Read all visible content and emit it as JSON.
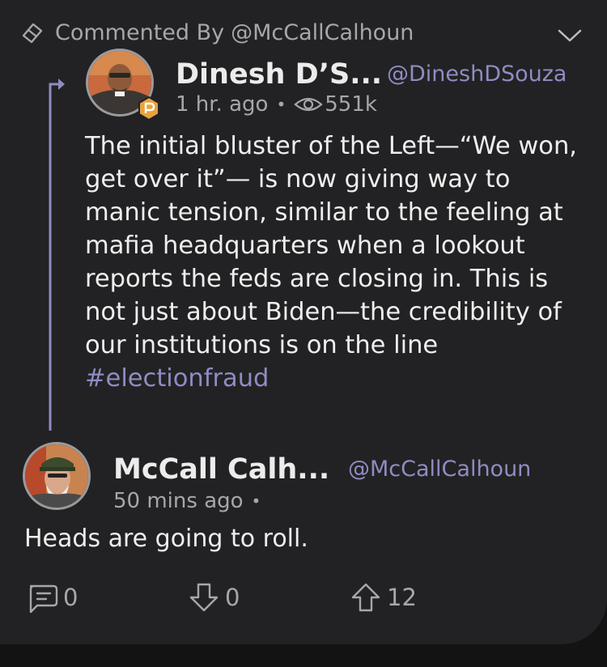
{
  "header": {
    "prefix": "Commented By",
    "handle": "@McCallCalhoun"
  },
  "original_post": {
    "author_name": "Dinesh D’S...",
    "author_handle": "@DineshDSouza",
    "time": "1 hr. ago",
    "separator": "•",
    "views": "551k",
    "text": "The initial bluster of the Left—“We won, get over it”— is now giving way to manic tension, similar to the feeling at mafia headquarters when a lookout reports the feds are closing in. This is not just about Biden—the credibility of our institutions is on the line",
    "hashtag": "#electionfraud"
  },
  "comment": {
    "author_name": "McCall Calh...",
    "author_handle": "@McCallCalhoun",
    "time": "50 mins ago",
    "separator": "•",
    "text": "Heads are going to roll."
  },
  "actions": {
    "reply_count": "0",
    "downvote_count": "0",
    "upvote_count": "12"
  },
  "colors": {
    "background": "#222224",
    "accent": "#8f8cc2",
    "muted": "#a7a7ab",
    "badge": "#e8a33d"
  }
}
